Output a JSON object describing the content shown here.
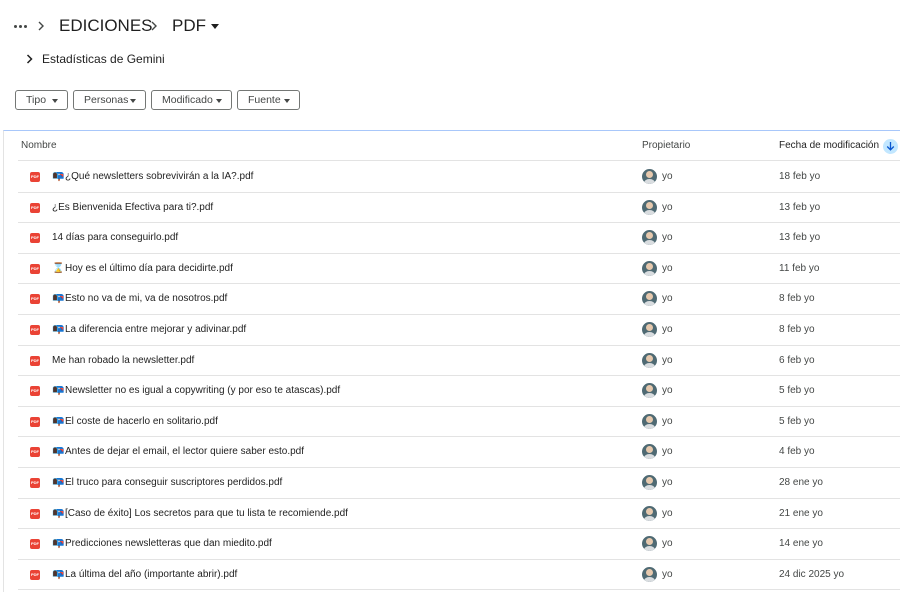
{
  "breadcrumb": {
    "more_label": "...",
    "parent": "EDICIONES",
    "current": "PDF"
  },
  "gemini": {
    "label": "Estadísticas de Gemini"
  },
  "filters": {
    "type": "Tipo",
    "people": "Personas",
    "modified": "Modificado",
    "source": "Fuente"
  },
  "columns": {
    "name": "Nombre",
    "owner": "Propietario",
    "modified": "Fecha de modificación",
    "sort_direction": "descending"
  },
  "file_type_icon": {
    "name": "pdf-icon",
    "color": "#ea4335",
    "text": "PDF"
  },
  "files": [
    {
      "prefix": "📭",
      "name": "¿Qué newsletters sobrevivirán a la IA?.pdf",
      "owner": "yo",
      "modified": "18 feb yo"
    },
    {
      "prefix": "",
      "name": "¿Es Bienvenida Efectiva para ti?.pdf",
      "owner": "yo",
      "modified": "13 feb yo"
    },
    {
      "prefix": "",
      "name": "14 días para conseguirlo.pdf",
      "owner": "yo",
      "modified": "13 feb yo"
    },
    {
      "prefix": "⌛",
      "name": "Hoy es el último día para decidirte.pdf",
      "owner": "yo",
      "modified": "11 feb yo"
    },
    {
      "prefix": "📭",
      "name": "Esto no va de mi, va de nosotros.pdf",
      "owner": "yo",
      "modified": "8 feb yo"
    },
    {
      "prefix": "📭",
      "name": "La diferencia entre mejorar y adivinar.pdf",
      "owner": "yo",
      "modified": "8 feb yo"
    },
    {
      "prefix": "",
      "name": "Me han robado la newsletter.pdf",
      "owner": "yo",
      "modified": "6 feb yo"
    },
    {
      "prefix": "📭",
      "name": "Newsletter no es igual a copywriting (y por eso te atascas).pdf",
      "owner": "yo",
      "modified": "5 feb yo"
    },
    {
      "prefix": "📭",
      "name": "El coste de hacerlo en solitario.pdf",
      "owner": "yo",
      "modified": "5 feb yo"
    },
    {
      "prefix": "📭",
      "name": "Antes de dejar el email, el lector quiere saber esto.pdf",
      "owner": "yo",
      "modified": "4 feb yo"
    },
    {
      "prefix": "📭",
      "name": "El truco para conseguir suscriptores perdidos.pdf",
      "owner": "yo",
      "modified": "28 ene yo"
    },
    {
      "prefix": "📭",
      "name": "[Caso de éxito] Los secretos para que tu lista te recomiende.pdf",
      "owner": "yo",
      "modified": "21 ene yo"
    },
    {
      "prefix": "📭",
      "name": "Predicciones newsletteras que dan miedito.pdf",
      "owner": "yo",
      "modified": "14 ene yo"
    },
    {
      "prefix": "📭",
      "name": "La última del año (importante abrir).pdf",
      "owner": "yo",
      "modified": "24 dic 2025 yo"
    }
  ]
}
